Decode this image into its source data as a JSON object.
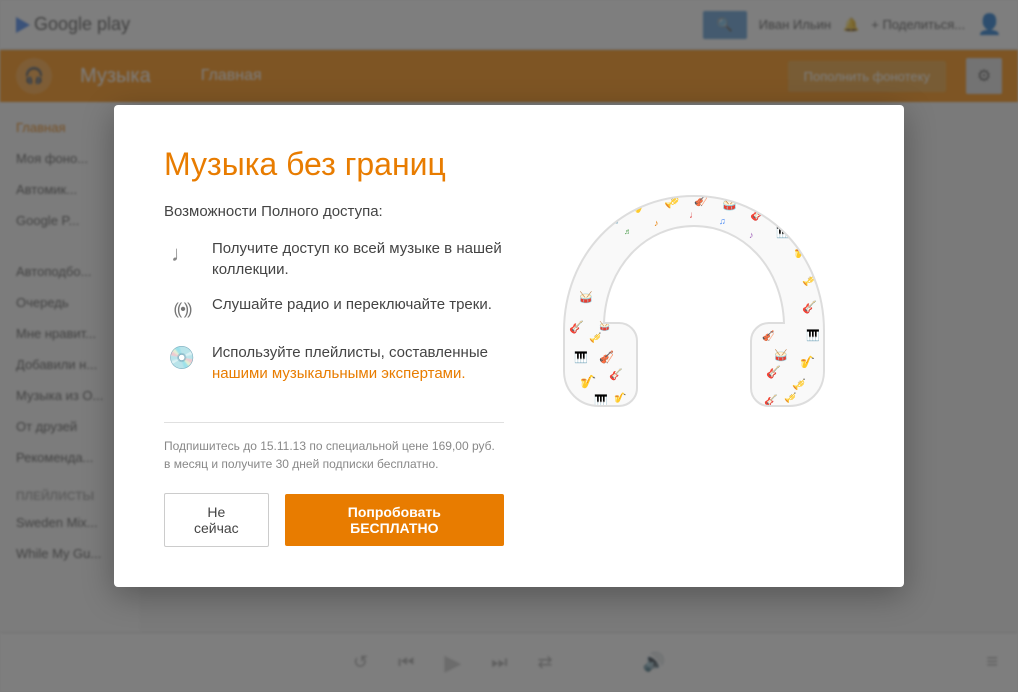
{
  "app": {
    "name": "Google play",
    "section": "Музыка"
  },
  "header": {
    "search_button": "🔍",
    "user_name": "Иван Ильин",
    "share_label": "+ Поделиться...",
    "fund_button": "Пополнить фонотеку",
    "settings_icon": "⚙"
  },
  "nav": {
    "home_label": "Главная"
  },
  "sidebar": {
    "items": [
      {
        "label": "Главная"
      },
      {
        "label": "Моя фоно..."
      },
      {
        "label": "Автомик..."
      },
      {
        "label": "Google P..."
      },
      {
        "label": "Автоподбо..."
      },
      {
        "label": "Очередь"
      },
      {
        "label": "Мне нравит..."
      },
      {
        "label": "Добавили н..."
      },
      {
        "label": "Музыка из О..."
      },
      {
        "label": "От друзей"
      },
      {
        "label": "Рекоменда..."
      },
      {
        "label": "плейлисты"
      },
      {
        "label": "Sweden Mix..."
      },
      {
        "label": "While My Gu..."
      }
    ]
  },
  "bottom_controls": {
    "repeat_icon": "↺",
    "prev_icon": "⏮",
    "play_icon": "▶",
    "next_icon": "⏭",
    "shuffle_icon": "⇄",
    "volume_icon": "🔊",
    "menu_icon": "≡"
  },
  "modal": {
    "title": "Музыка без границ",
    "subtitle": "Возможности Полного доступа:",
    "features": [
      {
        "icon": "♩♪",
        "text": "Получите доступ ко всей музыке в нашей коллекции."
      },
      {
        "icon": "((•))",
        "text": "Слушайте радио и переключайте треки."
      },
      {
        "icon": "💿",
        "text": "Используйте плейлисты, составленные нашими музыкальными экспертами."
      }
    ],
    "promo_text": "Подпишитесь до 15.11.13 по специальной цене 169,00 руб. в месяц и получите 30 дней подписки бесплатно.",
    "cancel_button": "Не сейчас",
    "try_button": "Попробовать БЕСПЛАТНО"
  }
}
